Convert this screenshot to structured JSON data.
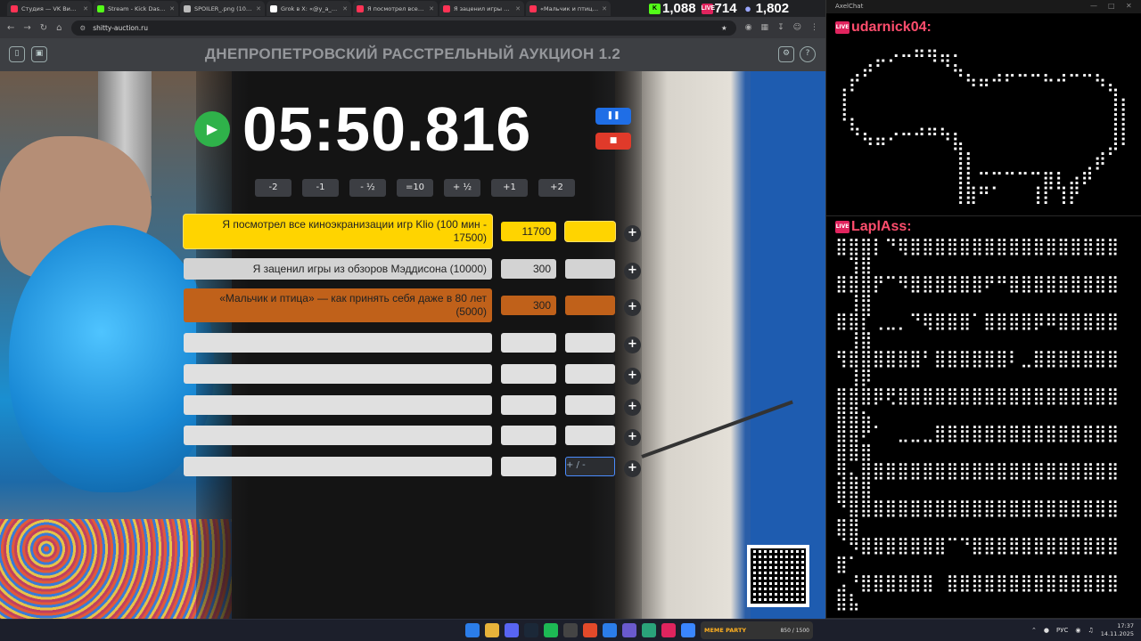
{
  "browser": {
    "tabs": [
      {
        "label": "Студия — VK Видео Li",
        "color": "#ff3355"
      },
      {
        "label": "Stream - Kick Dashboar",
        "color": "#53fc18"
      },
      {
        "label": "SPOILER_.png (1024×",
        "color": "#bbbbbb"
      },
      {
        "label": "Grok в X: «@y_a_d_i_r",
        "color": "#ffffff"
      },
      {
        "label": "Я посмотрел все кино",
        "color": "#ff3355"
      },
      {
        "label": "Я заценил игры из обз",
        "color": "#ff3355"
      },
      {
        "label": "«Мальчик и птица» —",
        "color": "#ff3355"
      }
    ],
    "url": "shitty-auction.ru"
  },
  "stream_stats": {
    "kick_viewers": "1,088",
    "vk_viewers": "714",
    "twitch_viewers": "1,802",
    "kick_color": "#53fc18",
    "vk_color": "#e0245e",
    "twitch_color": "#9aa7ff"
  },
  "app": {
    "title": "ДНЕПРОПЕТРОВСКИЙ РАССТРЕЛЬНЫЙ АУКЦИОН 1.2",
    "timer": "05:50.816",
    "adjust_buttons": [
      "-2",
      "-1",
      "- ½",
      "=10",
      "+ ½",
      "+1",
      "+2"
    ],
    "lots": [
      {
        "name": "Я посмотрел все киноэкранизации игр Klio (100 мин - 17500)",
        "amount": "11700",
        "color": "#ffd400",
        "leader": true
      },
      {
        "name": "Я заценил игры из обзоров Мэддисона (10000)",
        "amount": "300",
        "color": "#d3d3d3"
      },
      {
        "name": "«Мальчик и птица» — как принять себя даже в 80 лет (5000)",
        "amount": "300",
        "color": "#c0611a"
      },
      {
        "name": "",
        "amount": "",
        "color": "#e0e0e0"
      },
      {
        "name": "",
        "amount": "",
        "color": "#e0e0e0"
      },
      {
        "name": "",
        "amount": "",
        "color": "#e0e0e0"
      },
      {
        "name": "",
        "amount": "",
        "color": "#e0e0e0"
      },
      {
        "name": "",
        "amount": "",
        "color": "#e0e0e0"
      }
    ],
    "extra_placeholder": "+ / -"
  },
  "chat": {
    "window_title": "AxelChat",
    "messages": [
      {
        "user": "udarnick04:",
        "lines": [
          "⠀⠀⠀⠀⢀⣀⣤⣤⣀⡀⠀⠀⠀⠀⠀⠀⠀⠀⠀⠀⠀⠀⠀",
          "⠀⢀⡴⠋⠁⠀⠀⠈⠙⢦⡀⠀⢀⣀⣀⣀⡀⢀⣀⣀⡀⠀⠀",
          "⢠⠏⠀⠀⠀⠀⠀⠀⠀⠀⠙⠛⠉⠁⠀⠀⠉⠉⠀⠀⠙⢦⠀",
          "⢸⠀⠀⠀⠀⠀⠀⠀⠀⠀⠀⠀⠀⠀⠀⠀⠀⠀⠀⠀⠀⢸⡇",
          "⠈⢧⡀⠀⢀⣀⣠⣤⣄⡀⠀⠀⠀⠀⠀⠀⠀⠀⠀⠀⠀⢸⡇",
          "⠀⠀⠙⠛⠁⠀⠀⠀⠈⢷⡀⠀⠀⠀⠀⠀⠀⠀⠀⠀⢀⡼⠃",
          "⠀⠀⠀⠀⠀⠀⠀⠀⠀⢸⡇⣀⣀⣀⣀⣀⣀⡀⠀⣠⠟⠀⠀",
          "⠀⠀⠀⠀⠀⠀⠀⠀⠀⢸⣧⣤⠄⠀⠀⢠⡿⢧⣾⠋⠀⠀⠀",
          "⠀⠀⠀⠀⠀⠀⠀⠀⠀⠘⠛⠀⠀⠀⠀⠘⠃⠘⠃⠀⠀⠀⠀"
        ]
      },
      {
        "user": "LaplAss:",
        "lines": [
          "⣿⣿⣿⡇⠙⢿⣿⣿⣿⣿⣿⣿⣿⣿⣿⣿⣿⣿⣿⣿⣿⣿⣿",
          "⠀⢹⣿",
          "⣿⣿⣿⡟⠉⠻⣿⣿⣿⣿⣿⣿⠟⠛⣿⣿⣿⣿⣿⣿⣿⣿⣿",
          "⠀⢸⣿",
          "⣿⣿⡏⢀⣀⡀⠙⢿⣿⣿⣿⠁⣿⣿⣿⣿⡿⠿⣿⣿⣿⣿⣿",
          "⠀⢸⣿",
          "⢻⣿⣿⣿⣿⣿⣿⠃⣿⣿⣿⣿⣿⣿⠇⣀⣿⣿⣿⣿⣿⣿⣿",
          "⠀⢸⡿",
          "⣿⣿⣿⡿⢟⣿⣿⣿⣿⣿⣿⣿⣿⣿⣿⣿⣿⣿⣿⣿⣿⣿⣿",
          "⣿⣿⣦",
          "⣿⣿⠟⠁⠀⣀⣀⣀⣿⣿⣿⣿⣿⣿⣿⣿⣿⣿⣿⣿⣿⣿⣿",
          "⣿⣿⣿",
          "⢿⣄⣿⣿⣿⣿⣿⣿⣿⣿⣿⣿⣿⣿⣿⣿⣿⣿⣿⣿⣿⣿⣿",
          "⣿⣿⣿",
          "⠙⣿⣿⣿⣿⣿⣿⣿⣿⣿⣿⣿⣿⣿⣿⣿⣿⣿⣿⣿⣿⣿⣿",
          "⣿⣿",
          "⠈⠻⣿⣿⣿⣿⣿⣿⣿⠉⠙⣿⣿⣿⣿⣿⣿⣿⣿⣿⣿⣿⣿",
          "⣿⠁",
          "⣠⠘⣿⣿⣿⣿⣿⣿⠀⣿⣿⣿⣿⣿⣿⣿⣿⣿⣿⣿⣿⣿⣿",
          "⣿⣧"
        ]
      }
    ]
  },
  "taskbar": {
    "meme_label": "MEME PARTY",
    "meme_value": "850 / 1500",
    "lang": "РУС",
    "time": "17:37",
    "date": "14.11.2025"
  }
}
